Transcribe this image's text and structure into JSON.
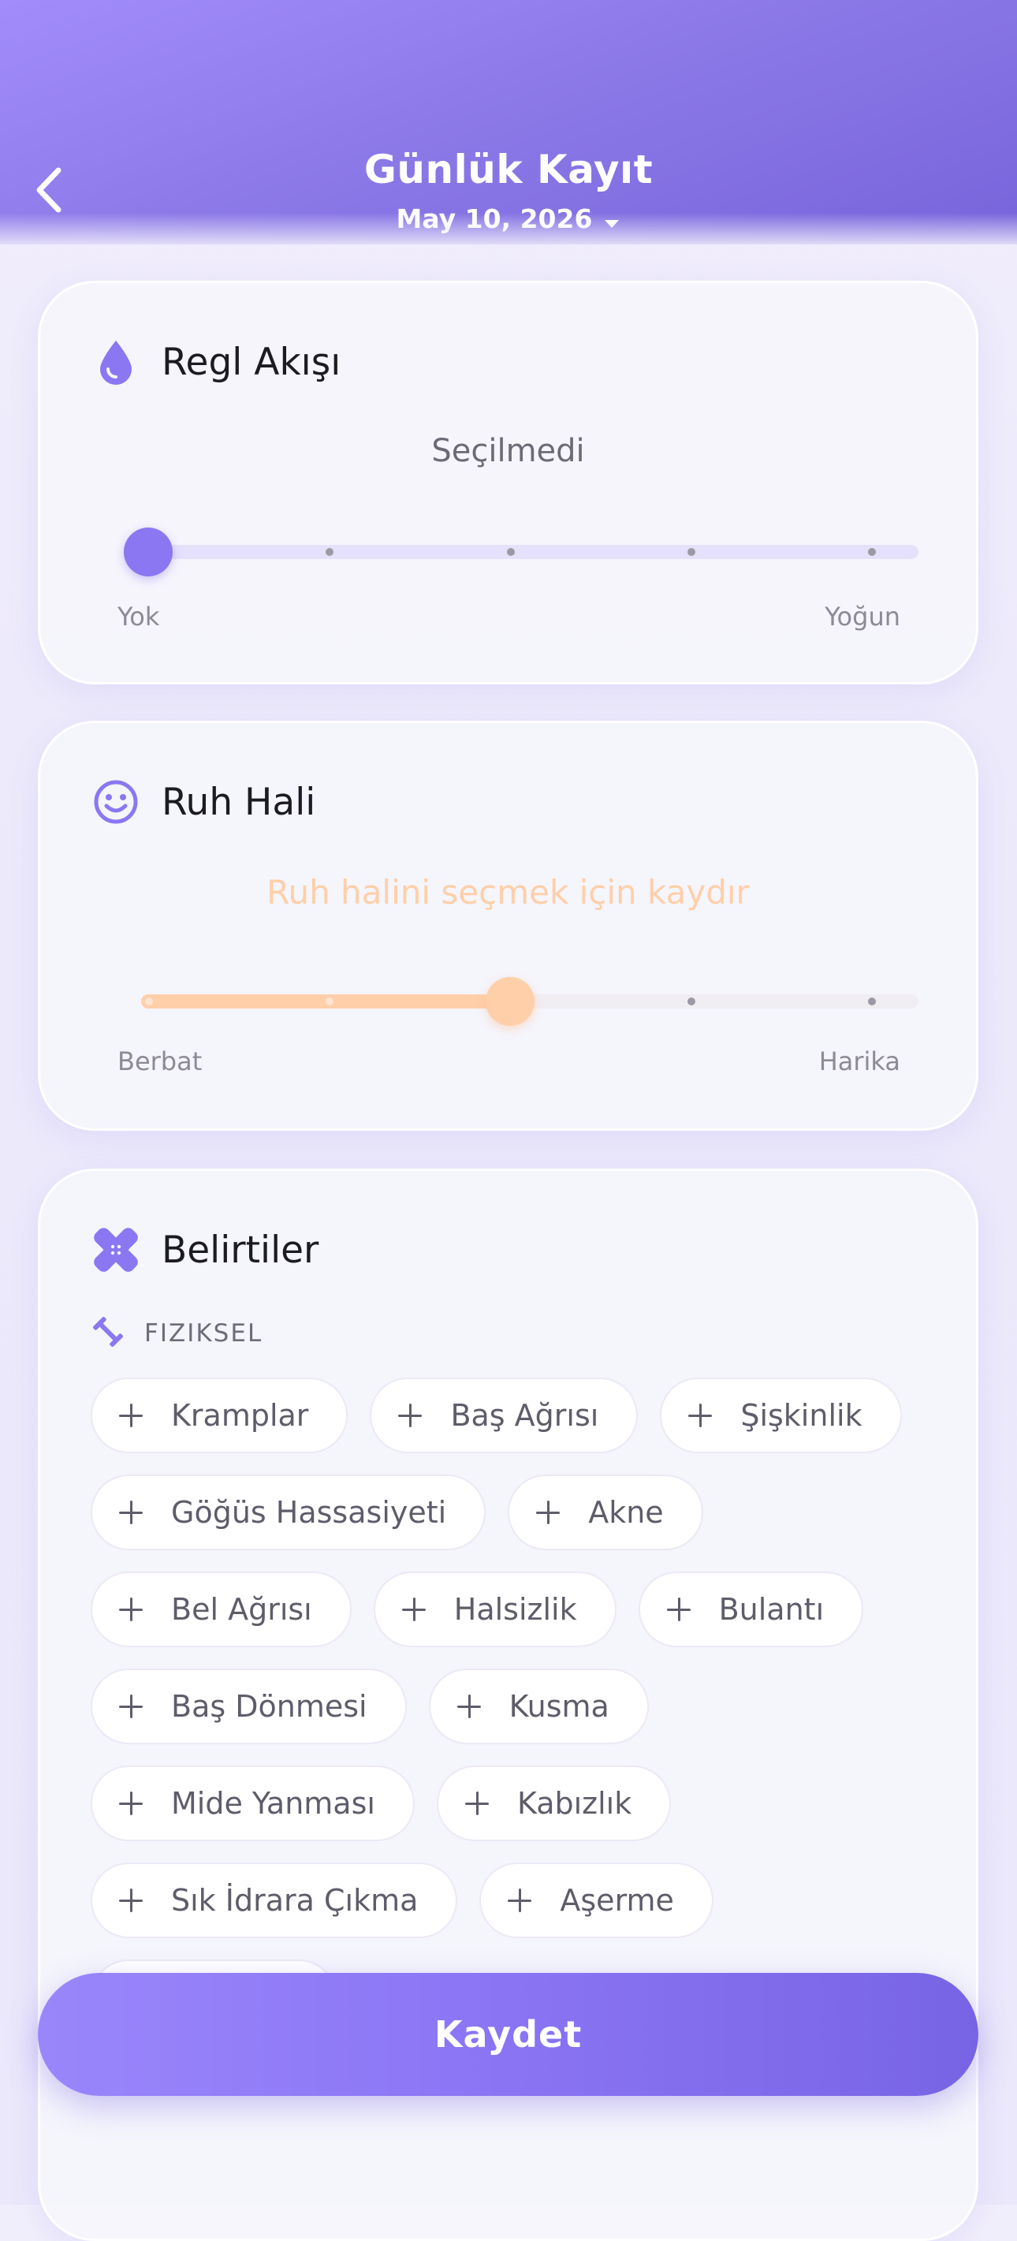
{
  "header": {
    "title": "Günlük Kayıt",
    "date": "May 10, 2026"
  },
  "flow": {
    "title": "Regl Akışı",
    "status": "Seçilmedi",
    "min_label": "Yok",
    "max_label": "Yoğun",
    "level": 0,
    "steps": 5
  },
  "mood": {
    "title": "Ruh Hali",
    "status": "Ruh halini seçmek için kaydır",
    "min_label": "Berbat",
    "max_label": "Harika",
    "level": 2,
    "steps": 5
  },
  "symptoms": {
    "title": "Belirtiler",
    "section": "FIZIKSEL",
    "rows": [
      [
        "Kramplar",
        "Baş Ağrısı",
        "Şişkinlik"
      ],
      [
        "Göğüs Hassasiyeti",
        "Akne"
      ],
      [
        "Bel Ağrısı",
        "Halsizlik",
        "Bulantı"
      ],
      [
        "Baş Dönmesi",
        "Kusma"
      ],
      [
        "Mide Yanması",
        "Kabızlık"
      ],
      [
        "Sık İdrara Çıkma",
        "Aşerme"
      ]
    ]
  },
  "save_label": "Kaydet",
  "colors": {
    "accent": "#8b77f2",
    "mood_accent": "#ffcfaa"
  }
}
